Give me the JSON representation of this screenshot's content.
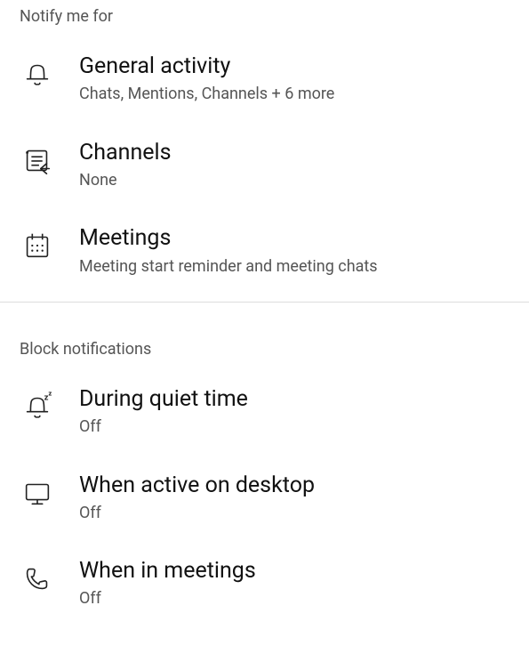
{
  "notifyHeader": "Notify me for",
  "items1": {
    "general": {
      "title": "General activity",
      "subtitle": "Chats, Mentions, Channels +  6 more"
    },
    "channels": {
      "title": "Channels",
      "subtitle": "None"
    },
    "meetings": {
      "title": "Meetings",
      "subtitle": "Meeting start reminder and meeting chats"
    }
  },
  "blockHeader": "Block notifications",
  "items2": {
    "quiet": {
      "title": "During quiet time",
      "subtitle": "Off"
    },
    "desktop": {
      "title": "When active on desktop",
      "subtitle": "Off"
    },
    "inMeetings": {
      "title": "When in meetings",
      "subtitle": "Off"
    }
  }
}
